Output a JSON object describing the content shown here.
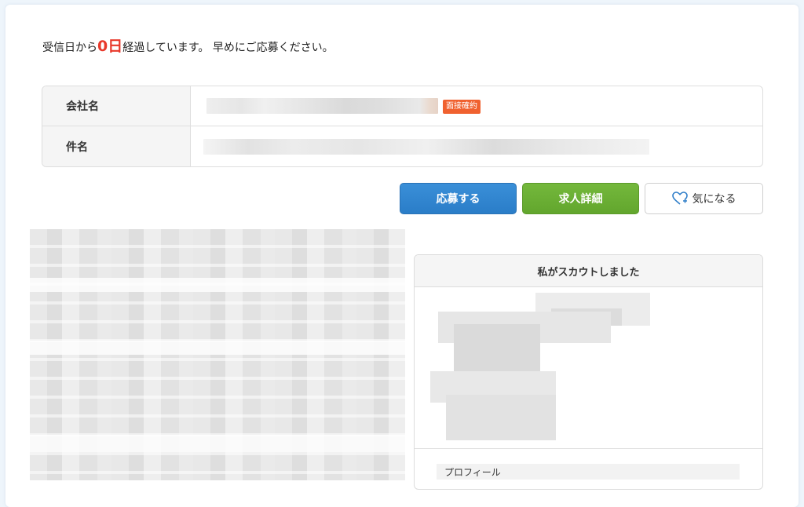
{
  "notice": {
    "prefix": "受信日から",
    "days": "0日",
    "suffix": "経過しています。 早めにご応募ください。"
  },
  "info": {
    "company_label": "会社名",
    "title_label": "件名",
    "badge": "面接確約"
  },
  "actions": {
    "apply": "応募する",
    "detail": "求人詳細",
    "favorite": "気になる",
    "favorite_icon": "heart-plus-icon"
  },
  "scout": {
    "heading": "私がスカウトしました",
    "profile_label": "プロフィール"
  },
  "colors": {
    "accent_red": "#e8392b",
    "badge": "#f0612f",
    "apply_blue": "#2a7dc8",
    "detail_green": "#62a62d",
    "favorite_heart": "#2f7ec9"
  }
}
